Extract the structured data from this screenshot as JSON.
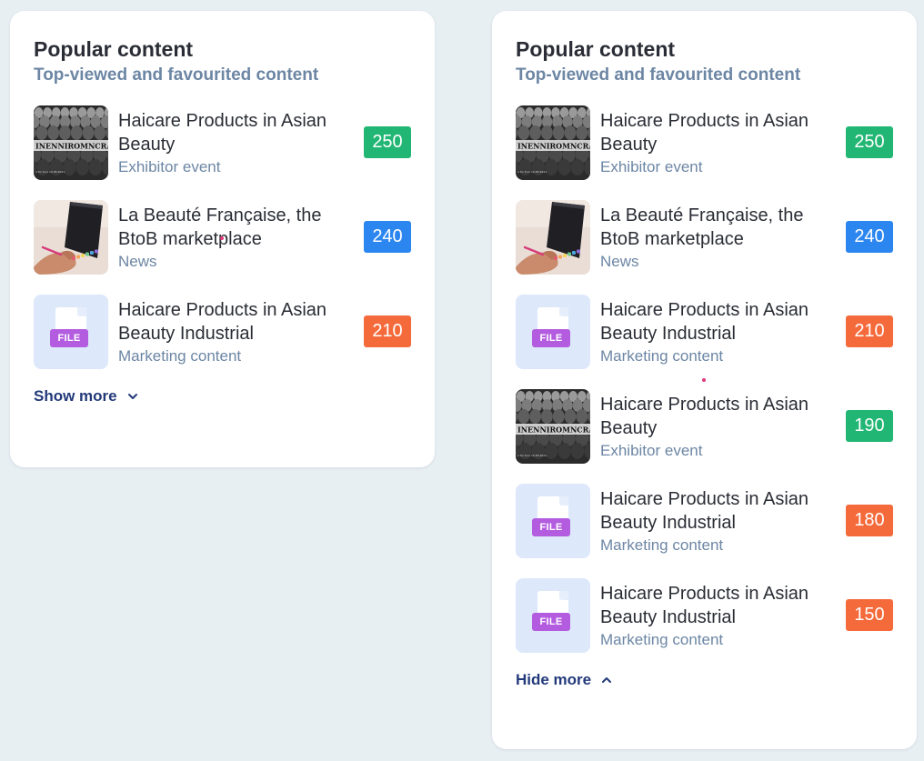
{
  "colors": {
    "green": "#21b673",
    "blue": "#2b86f0",
    "orange": "#f56a3b"
  },
  "left_card": {
    "title": "Popular content",
    "subtitle": "Top-viewed and favourited content",
    "items": [
      {
        "title": "Haicare Products in Asian Beauty",
        "type": "Exhibitor event",
        "count": "250",
        "thumb": "crowd-image",
        "color": "green"
      },
      {
        "title": "La Beauté Française, the BtoB marketplace",
        "type": "News",
        "count": "240",
        "thumb": "laptop-image",
        "color": "blue"
      },
      {
        "title": "Haicare Products in Asian Beauty Industrial",
        "type": "Marketing content",
        "count": "210",
        "thumb": "file-icon",
        "file_label": "FILE",
        "color": "orange"
      }
    ],
    "toggle_label": "Show more",
    "toggle_icon": "chevron-down-icon"
  },
  "right_card": {
    "title": "Popular content",
    "subtitle": "Top-viewed and favourited content",
    "items": [
      {
        "title": "Haicare Products in Asian Beauty",
        "type": "Exhibitor event",
        "count": "250",
        "thumb": "crowd-image",
        "color": "green"
      },
      {
        "title": "La Beauté Française, the BtoB marketplace",
        "type": "News",
        "count": "240",
        "thumb": "laptop-image",
        "color": "blue"
      },
      {
        "title": "Haicare Products in Asian Beauty Industrial",
        "type": "Marketing content",
        "count": "210",
        "thumb": "file-icon",
        "file_label": "FILE",
        "color": "orange"
      },
      {
        "title": "Haicare Products in Asian Beauty",
        "type": "Exhibitor event",
        "count": "190",
        "thumb": "crowd-image",
        "color": "green"
      },
      {
        "title": "Haicare Products in Asian Beauty Industrial",
        "type": "Marketing content",
        "count": "180",
        "thumb": "file-icon",
        "file_label": "FILE",
        "color": "orange"
      },
      {
        "title": "Haicare Products in Asian Beauty Industrial",
        "type": "Marketing content",
        "count": "150",
        "thumb": "file-icon",
        "file_label": "FILE",
        "color": "orange"
      }
    ],
    "toggle_label": "Hide more",
    "toggle_icon": "chevron-up-icon"
  }
}
